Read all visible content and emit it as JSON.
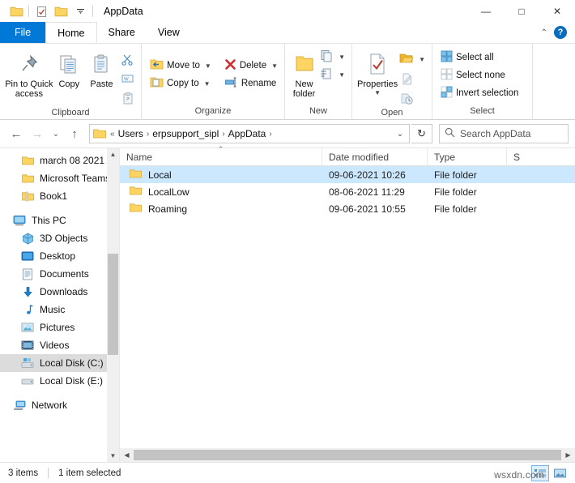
{
  "titlebar": {
    "title": "AppData",
    "quick_access": [
      {
        "name": "folder-icon"
      },
      {
        "name": "properties-icon"
      },
      {
        "name": "new-folder-icon"
      },
      {
        "name": "chevron-down-icon"
      }
    ],
    "minimize": "—",
    "maximize": "□",
    "close": "✕"
  },
  "tabs": [
    {
      "label": "File",
      "id": "file"
    },
    {
      "label": "Home",
      "id": "home"
    },
    {
      "label": "Share",
      "id": "share"
    },
    {
      "label": "View",
      "id": "view"
    }
  ],
  "tab_right": {
    "collapse": "⌃",
    "help": "?"
  },
  "ribbon": {
    "clipboard": {
      "label": "Clipboard",
      "pin": "Pin to Quick\naccess",
      "pin_line1": "Pin to Quick",
      "pin_line2": "access",
      "copy": "Copy",
      "paste": "Paste",
      "cut_icon": "scissors-icon",
      "copy_path_icon": "copy-path-icon",
      "paste_shortcut_icon": "paste-shortcut-icon"
    },
    "organize": {
      "label": "Organize",
      "move_to": "Move to",
      "copy_to": "Copy to",
      "delete": "Delete",
      "rename": "Rename"
    },
    "new": {
      "label": "New",
      "new_folder_line1": "New",
      "new_folder_line2": "folder",
      "new_item_icon": "new-item-icon",
      "easy_access_icon": "easy-access-icon"
    },
    "open": {
      "label": "Open",
      "properties": "Properties",
      "open_icon": "open-icon",
      "edit_icon": "edit-icon",
      "history_icon": "history-icon"
    },
    "select": {
      "label": "Select",
      "select_all": "Select all",
      "select_none": "Select none",
      "invert_selection": "Invert selection"
    }
  },
  "address": {
    "back": "←",
    "forward": "→",
    "recent": "⌄",
    "up": "↑",
    "overflow": "«",
    "crumbs": [
      "Users",
      "erpsupport_sipl",
      "AppData"
    ],
    "crumb_sep": "›",
    "dropdown": "⌄",
    "refresh": "↻",
    "search_placeholder": "Search AppData",
    "search_value": ""
  },
  "navpane": {
    "items": [
      {
        "label": "march 08 2021",
        "icon": "folder-icon",
        "indent": 1,
        "selected": false
      },
      {
        "label": "Microsoft Teams",
        "icon": "folder-icon",
        "indent": 1,
        "selected": false
      },
      {
        "label": "Book1",
        "icon": "zip-icon",
        "indent": 1,
        "selected": false
      },
      {
        "label": "",
        "icon": "gap",
        "indent": 0,
        "selected": false
      },
      {
        "label": "This PC",
        "icon": "pc-icon",
        "indent": 0,
        "selected": false
      },
      {
        "label": "3D Objects",
        "icon": "3d-objects-icon",
        "indent": 1,
        "selected": false
      },
      {
        "label": "Desktop",
        "icon": "desktop-icon",
        "indent": 1,
        "selected": false
      },
      {
        "label": "Documents",
        "icon": "documents-icon",
        "indent": 1,
        "selected": false
      },
      {
        "label": "Downloads",
        "icon": "downloads-icon",
        "indent": 1,
        "selected": false
      },
      {
        "label": "Music",
        "icon": "music-icon",
        "indent": 1,
        "selected": false
      },
      {
        "label": "Pictures",
        "icon": "pictures-icon",
        "indent": 1,
        "selected": false
      },
      {
        "label": "Videos",
        "icon": "videos-icon",
        "indent": 1,
        "selected": false
      },
      {
        "label": "Local Disk (C:)",
        "icon": "drive-icon",
        "indent": 1,
        "selected": true
      },
      {
        "label": "Local Disk (E:)",
        "icon": "drive-plain-icon",
        "indent": 1,
        "selected": false
      },
      {
        "label": "",
        "icon": "gap",
        "indent": 0,
        "selected": false
      },
      {
        "label": "Network",
        "icon": "network-icon",
        "indent": 0,
        "selected": false
      }
    ]
  },
  "filelist": {
    "columns": [
      {
        "key": "name",
        "label": "Name"
      },
      {
        "key": "date",
        "label": "Date modified"
      },
      {
        "key": "type",
        "label": "Type"
      },
      {
        "key": "size",
        "label": "S"
      }
    ],
    "sort_indicator": "⌃",
    "rows": [
      {
        "name": "Local",
        "date": "09-06-2021 10:26",
        "type": "File folder",
        "size": "",
        "selected": true
      },
      {
        "name": "LocalLow",
        "date": "08-06-2021 11:29",
        "type": "File folder",
        "size": "",
        "selected": false
      },
      {
        "name": "Roaming",
        "date": "09-06-2021 10:55",
        "type": "File folder",
        "size": "",
        "selected": false
      }
    ]
  },
  "statusbar": {
    "item_count": "3 items",
    "selection": "1 item selected",
    "details_view_icon": "details-view-icon",
    "large-icons_view_icon": "large-icons-view-icon"
  },
  "watermark": "wsxdn.com",
  "colors": {
    "accent": "#0078d7",
    "selection": "#cce8ff",
    "nav_selection": "#dcdcdc",
    "folder_yellow": "#fcd462",
    "delete_red": "#d32f2f",
    "scrollbar": "#c3c3c3"
  }
}
